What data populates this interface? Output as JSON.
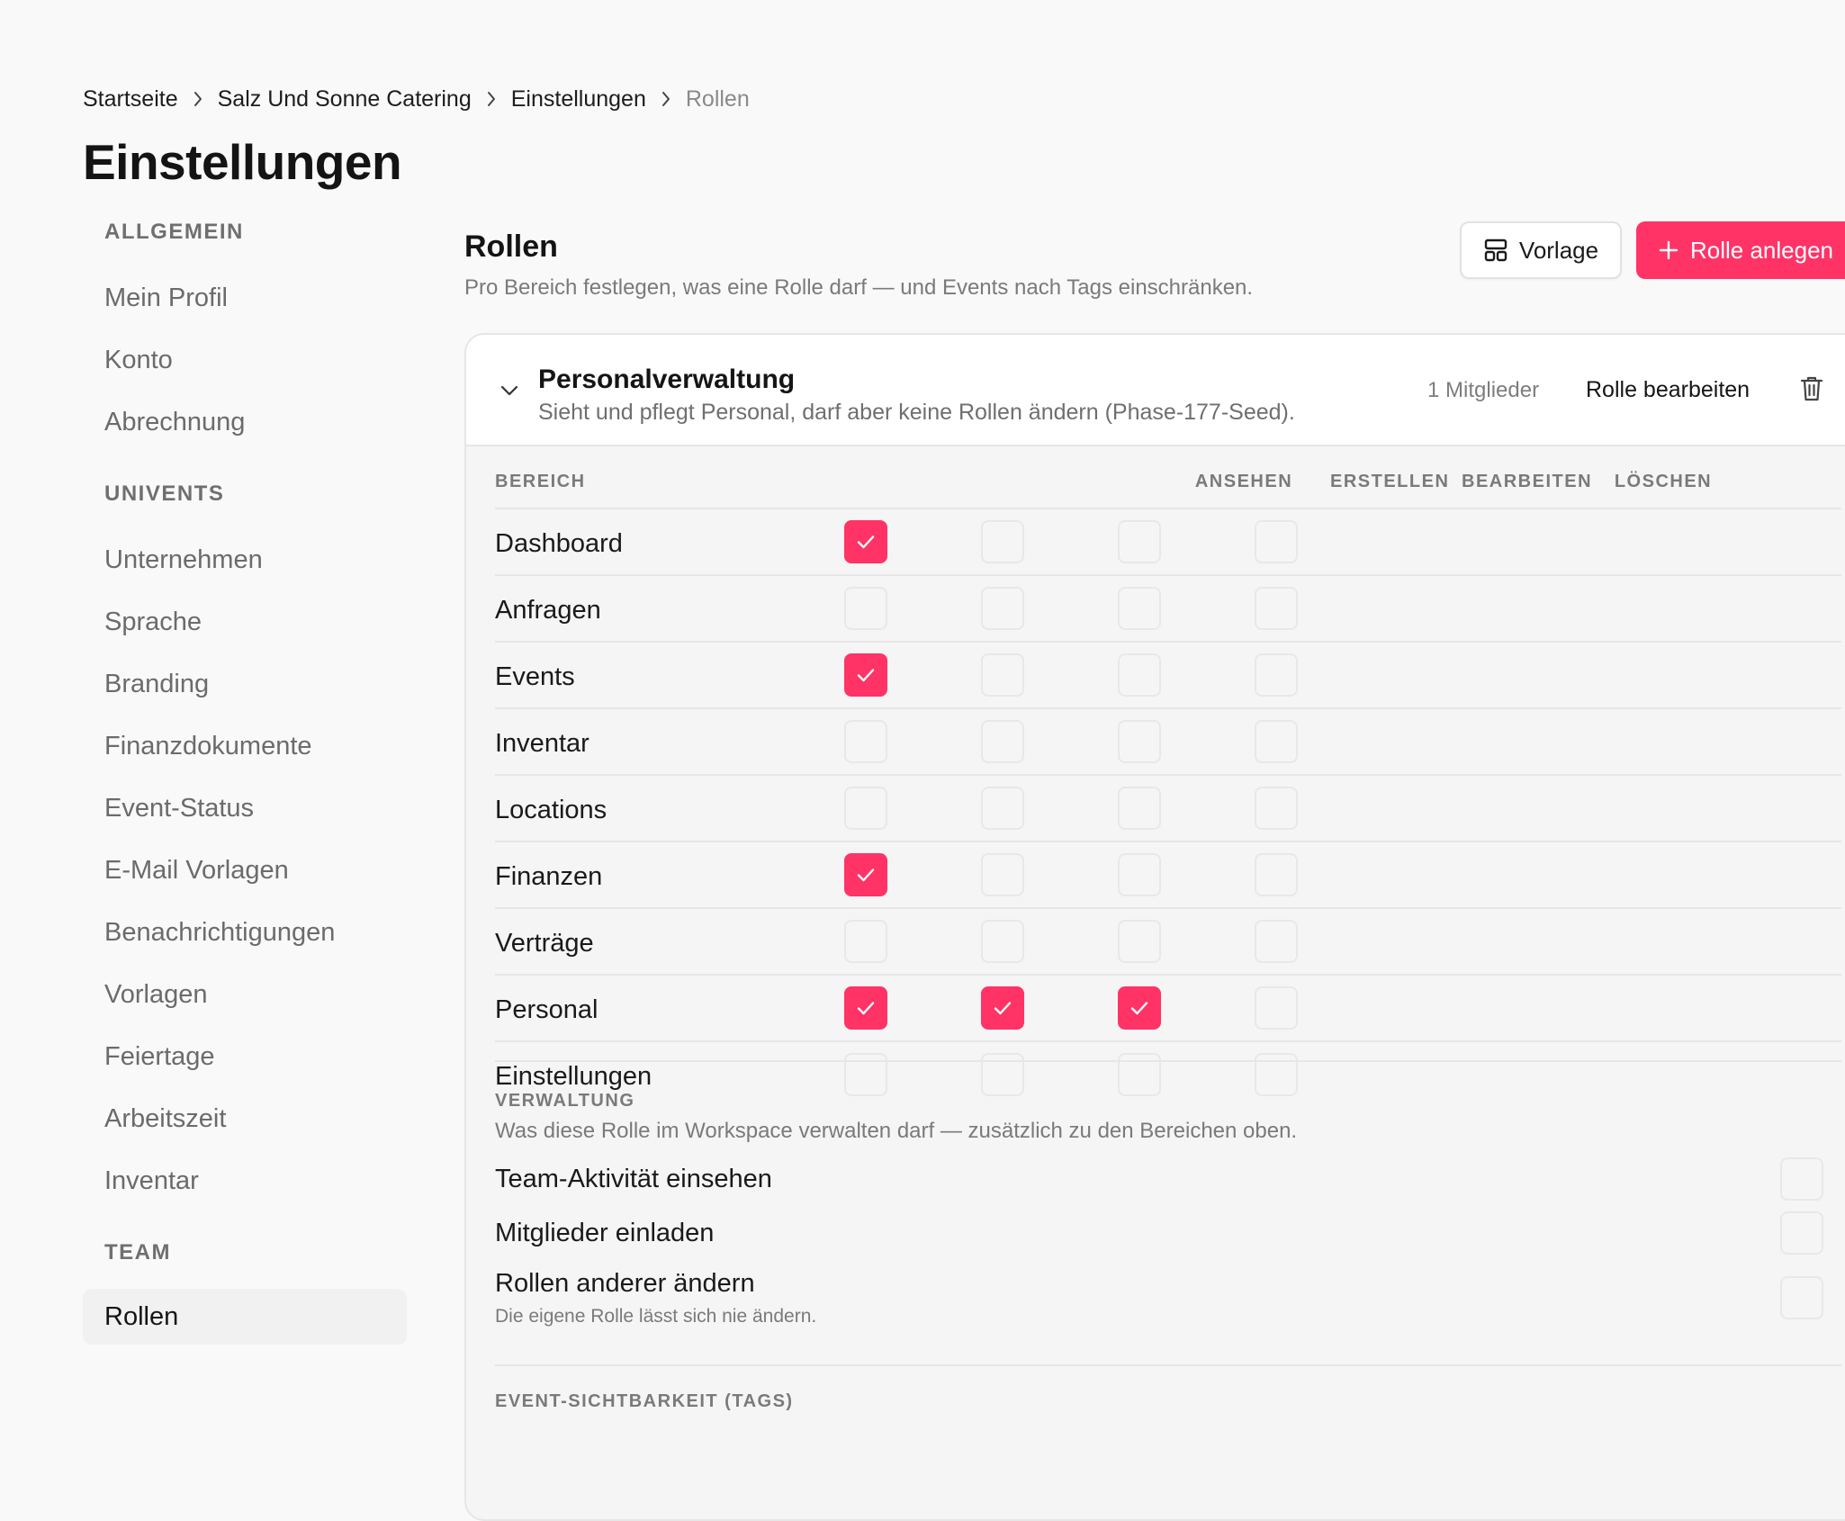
{
  "breadcrumb": [
    "Startseite",
    "Salz Und Sonne Catering",
    "Einstellungen",
    "Rollen"
  ],
  "page_title": "Einstellungen",
  "sidebar": {
    "groups": [
      {
        "heading": "ALLGEMEIN",
        "items": [
          "Mein Profil",
          "Konto",
          "Abrechnung"
        ]
      },
      {
        "heading": "UNIVENTS",
        "items": [
          "Unternehmen",
          "Sprache",
          "Branding",
          "Finanzdokumente",
          "Event-Status",
          "E-Mail Vorlagen",
          "Benachrichtigungen",
          "Vorlagen",
          "Feiertage",
          "Arbeitszeit",
          "Inventar"
        ]
      },
      {
        "heading": "TEAM",
        "items": [
          "Rollen"
        ]
      }
    ],
    "active_item": "Rollen"
  },
  "section": {
    "title": "Rollen",
    "description": "Pro Bereich festlegen, was eine Rolle darf — und Events nach Tags einschränken."
  },
  "buttons": {
    "template": "Vorlage",
    "create_role": "Rolle anlegen"
  },
  "colors": {
    "accent": "#ff3366"
  },
  "role": {
    "name": "Personalverwaltung",
    "description": "Sieht und pflegt Personal, darf aber keine Rollen ändern (Phase-177-Seed).",
    "members": "1 Mitglieder",
    "edit_label": "Rolle bearbeiten"
  },
  "permissions": {
    "columns": [
      "BEREICH",
      "ANSEHEN",
      "ERSTELLEN",
      "BEARBEITEN",
      "LÖSCHEN"
    ],
    "rows": [
      {
        "label": "Dashboard",
        "values": [
          true,
          false,
          false,
          false
        ]
      },
      {
        "label": "Anfragen",
        "values": [
          false,
          false,
          false,
          false
        ]
      },
      {
        "label": "Events",
        "values": [
          true,
          false,
          false,
          false
        ]
      },
      {
        "label": "Inventar",
        "values": [
          false,
          false,
          false,
          false
        ]
      },
      {
        "label": "Locations",
        "values": [
          false,
          false,
          false,
          false
        ]
      },
      {
        "label": "Finanzen",
        "values": [
          true,
          false,
          false,
          false
        ]
      },
      {
        "label": "Verträge",
        "values": [
          false,
          false,
          false,
          false
        ]
      },
      {
        "label": "Personal",
        "values": [
          true,
          true,
          true,
          false
        ]
      },
      {
        "label": "Einstellungen",
        "values": [
          false,
          false,
          false,
          false
        ]
      }
    ]
  },
  "administration": {
    "heading": "VERWALTUNG",
    "description": "Was diese Rolle im Workspace verwalten darf — zusätzlich zu den Bereichen oben.",
    "items": [
      {
        "label": "Team-Aktivität einsehen",
        "note": "",
        "checked": false
      },
      {
        "label": "Mitglieder einladen",
        "note": "",
        "checked": false
      },
      {
        "label": "Rollen anderer ändern",
        "note": "Die eigene Rolle lässt sich nie ändern.",
        "checked": false
      }
    ]
  },
  "event_visibility": {
    "heading": "EVENT-SICHTBARKEIT (TAGS)"
  },
  "icons": {
    "breadcrumb_separator": "chevron-right-icon",
    "template": "layout-template-icon",
    "create": "plus-icon",
    "collapse": "chevron-down-icon",
    "delete": "trash-icon",
    "check": "check-icon"
  }
}
